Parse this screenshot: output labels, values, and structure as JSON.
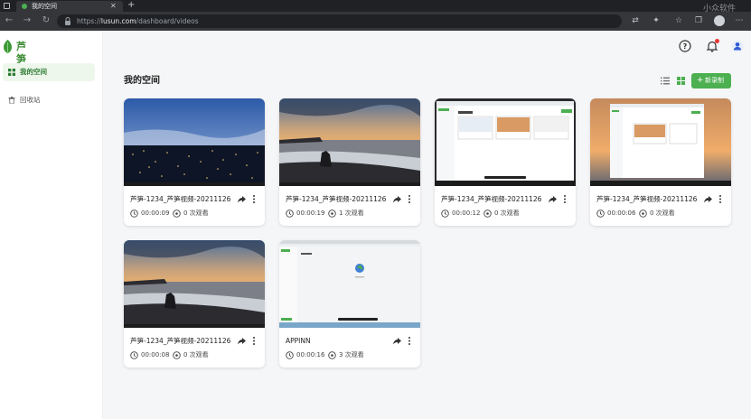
{
  "browser": {
    "tab_title": "我的空间",
    "tab_close": "✕",
    "new_tab": "+",
    "url_scheme": "https://",
    "url_host": "lusun.com",
    "url_path": "/dashboard/videos",
    "watermark": "小众软件"
  },
  "app": {
    "logo_text": "芦笋",
    "sidebar": {
      "items": [
        {
          "label": "我的空间",
          "icon": "grid-icon",
          "active": true
        },
        {
          "label": "回收站",
          "icon": "trash-icon",
          "active": false
        }
      ]
    },
    "header": {
      "help_icon": "help-icon",
      "bell_icon": "bell-icon",
      "avatar_icon": "user-avatar-icon"
    },
    "main": {
      "title": "我的空间",
      "new_button_plus": "+",
      "new_button_label": "新录制",
      "cards": [
        {
          "title": "芦笋-1234_芦笋视频-20211126",
          "duration": "00:00:09",
          "views": "0 次观看",
          "thumb": "night-city"
        },
        {
          "title": "芦笋-1234_芦笋视频-20211126",
          "duration": "00:00:19",
          "views": "1 次观看",
          "thumb": "sunset-beach"
        },
        {
          "title": "芦笋-1234_芦笋视频-20211126",
          "duration": "00:00:12",
          "views": "0 次观看",
          "thumb": "screen-grid"
        },
        {
          "title": "芦笋-1234_芦笋视频-20211126",
          "duration": "00:00:06",
          "views": "0 次观看",
          "thumb": "sunset-screen"
        },
        {
          "title": "芦笋-1234_芦笋视频-20211126",
          "duration": "00:00:08",
          "views": "0 次观看",
          "thumb": "sunset-beach"
        },
        {
          "title": "APPINN",
          "duration": "00:00:16",
          "views": "3 次观看",
          "thumb": "white-screen"
        }
      ]
    }
  },
  "colors": {
    "brand_green": "#4caf50",
    "sidebar_active_bg": "#eef7ec",
    "browser_dark": "#202124"
  }
}
